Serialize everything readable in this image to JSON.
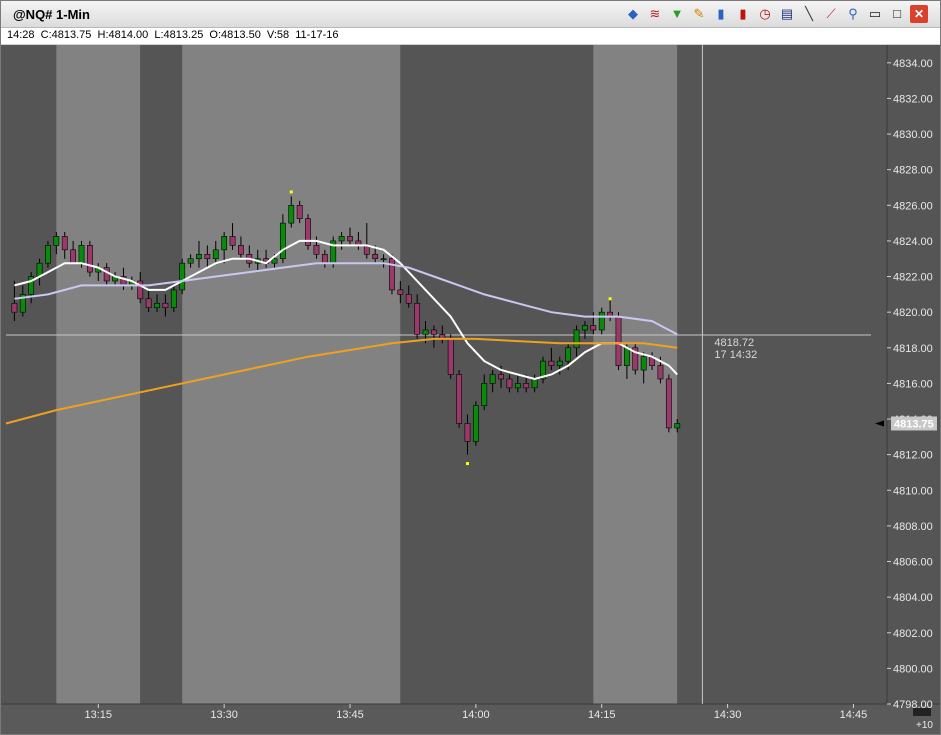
{
  "window": {
    "title": "@NQ# 1-Min",
    "info": "14:28  C:4813.75  H:4814.00  L:4813.25  O:4813.50  V:58  11-17-16"
  },
  "toolbar": [
    {
      "name": "data-icon",
      "glyph": "◆",
      "color": "#2a62c4"
    },
    {
      "name": "rainbow-icon",
      "glyph": "≋",
      "color": "#c02020"
    },
    {
      "name": "funnel-icon",
      "glyph": "▼",
      "color": "#22a022"
    },
    {
      "name": "pencil-icon",
      "glyph": "✎",
      "color": "#d08000"
    },
    {
      "name": "bar-chart-icon",
      "glyph": "▮",
      "color": "#2a62c4"
    },
    {
      "name": "candle-icon",
      "glyph": "▮",
      "color": "#c01010"
    },
    {
      "name": "clock-icon",
      "glyph": "◷",
      "color": "#b01010"
    },
    {
      "name": "document-icon",
      "glyph": "▤",
      "color": "#203080"
    },
    {
      "name": "trendline-icon",
      "glyph": "╲",
      "color": "#303030"
    },
    {
      "name": "zigzag-icon",
      "glyph": "⟋",
      "color": "#c02080"
    },
    {
      "name": "pin-icon",
      "glyph": "⚲",
      "color": "#2a62c4"
    },
    {
      "name": "minimize-icon",
      "glyph": "▭",
      "color": "#202020"
    },
    {
      "name": "maximize-icon",
      "glyph": "□",
      "color": "#202020"
    },
    {
      "name": "close-icon",
      "glyph": "✕",
      "color": "#ffffff"
    }
  ],
  "colors": {
    "dark_band": "#555555",
    "light_band": "#828282",
    "axis_bg": "#555555",
    "up_candle": "#0a8a0a",
    "down_candle": "#9a3a6a",
    "wick": "#000000",
    "ma_white": "#ffffff",
    "ma_lavender": "#c8c8f0",
    "ma_orange": "#f0a020",
    "crosshair": "#c8c8c8",
    "marker": "#ffff00",
    "price_label_bg": "#c8c8c8"
  },
  "chart_data": {
    "type": "candlestick",
    "xlim": [
      "13:04",
      "14:49"
    ],
    "ylim": [
      4798,
      4835
    ],
    "y_ticks": [
      4798,
      4800,
      4802,
      4804,
      4806,
      4808,
      4810,
      4812,
      4814,
      4816,
      4818,
      4820,
      4822,
      4824,
      4826,
      4828,
      4830,
      4832,
      4834
    ],
    "y_tick_labels": [
      "4798.00",
      "4800.00",
      "4802.00",
      "4804.00",
      "4806.00",
      "4808.00",
      "4810.00",
      "4812.00",
      "4814.00",
      "4816.00",
      "4818.00",
      "4820.00",
      "4822.00",
      "4824.00",
      "4826.00",
      "4828.00",
      "4830.00",
      "4832.00",
      "4834.00"
    ],
    "x_ticks": [
      "13:15",
      "13:30",
      "13:45",
      "14:00",
      "14:15",
      "14:30",
      "14:45"
    ],
    "x_axis_extra": "+10",
    "bands": [
      {
        "start": "13:04",
        "end": "13:10",
        "shade": "dark"
      },
      {
        "start": "13:10",
        "end": "13:20",
        "shade": "light"
      },
      {
        "start": "13:20",
        "end": "13:25",
        "shade": "dark"
      },
      {
        "start": "13:25",
        "end": "13:51",
        "shade": "light"
      },
      {
        "start": "13:51",
        "end": "14:14",
        "shade": "dark"
      },
      {
        "start": "14:14",
        "end": "14:24",
        "shade": "light"
      },
      {
        "start": "14:24",
        "end": "14:49",
        "shade": "dark"
      }
    ],
    "candles": [
      [
        "13:05",
        4820.5,
        4821.75,
        4819.5,
        4820.0
      ],
      [
        "13:06",
        4820.0,
        4821.5,
        4819.75,
        4821.0
      ],
      [
        "13:07",
        4821.0,
        4822.25,
        4820.5,
        4822.0
      ],
      [
        "13:08",
        4822.0,
        4823.0,
        4821.5,
        4822.75
      ],
      [
        "13:09",
        4822.75,
        4824.0,
        4822.5,
        4823.75
      ],
      [
        "13:10",
        4823.75,
        4824.5,
        4823.25,
        4824.25
      ],
      [
        "13:11",
        4824.25,
        4824.5,
        4823.0,
        4823.5
      ],
      [
        "13:12",
        4823.5,
        4824.0,
        4822.75,
        4822.75
      ],
      [
        "13:13",
        4822.75,
        4824.0,
        4822.5,
        4823.75
      ],
      [
        "13:14",
        4823.75,
        4824.0,
        4822.0,
        4822.25
      ],
      [
        "13:15",
        4822.25,
        4822.75,
        4821.75,
        4822.5
      ],
      [
        "13:16",
        4822.5,
        4822.75,
        4821.5,
        4821.75
      ],
      [
        "13:17",
        4821.75,
        4822.25,
        4821.5,
        4822.0
      ],
      [
        "13:18",
        4822.0,
        4822.5,
        4821.25,
        4821.5
      ],
      [
        "13:19",
        4821.5,
        4822.0,
        4821.25,
        4821.75
      ],
      [
        "13:20",
        4821.75,
        4822.25,
        4820.5,
        4820.75
      ],
      [
        "13:21",
        4820.75,
        4821.25,
        4820.0,
        4820.25
      ],
      [
        "13:22",
        4820.25,
        4821.0,
        4820.0,
        4820.5
      ],
      [
        "13:23",
        4820.5,
        4821.0,
        4819.75,
        4820.25
      ],
      [
        "13:24",
        4820.25,
        4821.5,
        4820.0,
        4821.25
      ],
      [
        "13:25",
        4821.25,
        4823.0,
        4821.0,
        4822.75
      ],
      [
        "13:26",
        4822.75,
        4823.25,
        4822.5,
        4823.0
      ],
      [
        "13:27",
        4823.0,
        4824.0,
        4822.5,
        4823.25
      ],
      [
        "13:28",
        4823.25,
        4823.75,
        4822.5,
        4823.0
      ],
      [
        "13:29",
        4823.0,
        4824.0,
        4822.75,
        4823.5
      ],
      [
        "13:30",
        4823.5,
        4824.5,
        4822.75,
        4824.25
      ],
      [
        "13:31",
        4824.25,
        4825.0,
        4823.5,
        4823.75
      ],
      [
        "13:32",
        4823.75,
        4824.25,
        4823.0,
        4823.25
      ],
      [
        "13:33",
        4823.25,
        4823.75,
        4822.5,
        4822.75
      ],
      [
        "13:34",
        4822.75,
        4823.5,
        4822.25,
        4823.0
      ],
      [
        "13:35",
        4823.0,
        4823.5,
        4822.5,
        4822.75
      ],
      [
        "13:36",
        4822.75,
        4823.25,
        4822.5,
        4823.0
      ],
      [
        "13:37",
        4823.0,
        4825.5,
        4822.75,
        4825.0
      ],
      [
        "13:38",
        4825.0,
        4826.5,
        4824.75,
        4826.0
      ],
      [
        "13:39",
        4826.0,
        4826.25,
        4825.0,
        4825.25
      ],
      [
        "13:40",
        4825.25,
        4825.5,
        4823.5,
        4823.75
      ],
      [
        "13:41",
        4823.75,
        4824.25,
        4823.0,
        4823.25
      ],
      [
        "13:42",
        4823.25,
        4823.5,
        4822.5,
        4822.75
      ],
      [
        "13:43",
        4822.75,
        4824.25,
        4822.5,
        4824.0
      ],
      [
        "13:44",
        4824.0,
        4824.5,
        4823.5,
        4824.25
      ],
      [
        "13:45",
        4824.25,
        4824.75,
        4823.75,
        4824.0
      ],
      [
        "13:46",
        4824.0,
        4824.5,
        4823.5,
        4823.75
      ],
      [
        "13:47",
        4823.75,
        4825.0,
        4823.0,
        4823.25
      ],
      [
        "13:48",
        4823.25,
        4823.75,
        4822.75,
        4823.0
      ],
      [
        "13:49",
        4823.0,
        4823.25,
        4822.5,
        4823.0
      ],
      [
        "13:50",
        4823.0,
        4823.25,
        4821.0,
        4821.25
      ],
      [
        "13:51",
        4821.25,
        4821.75,
        4820.5,
        4821.0
      ],
      [
        "13:52",
        4821.0,
        4821.5,
        4820.25,
        4820.5
      ],
      [
        "13:53",
        4820.5,
        4821.0,
        4818.5,
        4818.75
      ],
      [
        "13:54",
        4818.75,
        4819.5,
        4818.25,
        4819.0
      ],
      [
        "13:55",
        4819.0,
        4819.25,
        4818.0,
        4818.75
      ],
      [
        "13:56",
        4818.75,
        4819.25,
        4818.25,
        4818.5
      ],
      [
        "13:57",
        4818.5,
        4818.75,
        4816.25,
        4816.5
      ],
      [
        "13:58",
        4816.5,
        4816.75,
        4813.5,
        4813.75
      ],
      [
        "13:59",
        4813.75,
        4814.25,
        4812.0,
        4812.75
      ],
      [
        "14:00",
        4812.75,
        4815.0,
        4812.5,
        4814.75
      ],
      [
        "14:01",
        4814.75,
        4816.5,
        4814.5,
        4816.0
      ],
      [
        "14:02",
        4816.0,
        4816.75,
        4815.5,
        4816.5
      ],
      [
        "14:03",
        4816.5,
        4817.0,
        4815.75,
        4816.25
      ],
      [
        "14:04",
        4816.25,
        4816.5,
        4815.5,
        4815.75
      ],
      [
        "14:05",
        4815.75,
        4816.5,
        4815.5,
        4816.0
      ],
      [
        "14:06",
        4816.0,
        4816.5,
        4815.5,
        4815.75
      ],
      [
        "14:07",
        4815.75,
        4816.5,
        4815.5,
        4816.25
      ],
      [
        "14:08",
        4816.25,
        4817.5,
        4816.0,
        4817.25
      ],
      [
        "14:09",
        4817.25,
        4818.0,
        4816.75,
        4817.0
      ],
      [
        "14:10",
        4817.0,
        4817.5,
        4816.5,
        4817.25
      ],
      [
        "14:11",
        4817.25,
        4818.25,
        4816.75,
        4818.0
      ],
      [
        "14:12",
        4818.0,
        4819.25,
        4817.5,
        4819.0
      ],
      [
        "14:13",
        4819.0,
        4819.5,
        4818.5,
        4819.25
      ],
      [
        "14:14",
        4819.25,
        4820.0,
        4818.75,
        4819.0
      ],
      [
        "14:15",
        4819.0,
        4820.25,
        4818.75,
        4820.0
      ],
      [
        "14:16",
        4820.0,
        4820.75,
        4819.5,
        4819.75
      ],
      [
        "14:17",
        4819.75,
        4820.0,
        4816.75,
        4817.0
      ],
      [
        "14:18",
        4817.0,
        4818.25,
        4816.25,
        4818.0
      ],
      [
        "14:19",
        4818.0,
        4818.25,
        4816.5,
        4816.75
      ],
      [
        "14:20",
        4816.75,
        4817.75,
        4816.0,
        4817.5
      ],
      [
        "14:21",
        4817.5,
        4817.75,
        4816.75,
        4817.0
      ],
      [
        "14:22",
        4817.0,
        4817.5,
        4816.0,
        4816.25
      ],
      [
        "14:23",
        4816.25,
        4816.5,
        4813.25,
        4813.5
      ],
      [
        "14:24",
        4813.5,
        4814.0,
        4813.25,
        4813.75
      ]
    ],
    "series": [
      {
        "color": "white",
        "points": [
          [
            "13:05",
            4821.5
          ],
          [
            "13:07",
            4821.75
          ],
          [
            "13:09",
            4822.25
          ],
          [
            "13:11",
            4822.75
          ],
          [
            "13:13",
            4822.75
          ],
          [
            "13:15",
            4822.5
          ],
          [
            "13:17",
            4822.0
          ],
          [
            "13:19",
            4821.75
          ],
          [
            "13:21",
            4821.25
          ],
          [
            "13:23",
            4821.25
          ],
          [
            "13:25",
            4821.75
          ],
          [
            "13:27",
            4822.25
          ],
          [
            "13:29",
            4822.75
          ],
          [
            "13:31",
            4823.0
          ],
          [
            "13:33",
            4823.0
          ],
          [
            "13:35",
            4822.75
          ],
          [
            "13:37",
            4823.5
          ],
          [
            "13:39",
            4824.0
          ],
          [
            "13:41",
            4824.0
          ],
          [
            "13:43",
            4823.75
          ],
          [
            "13:45",
            4823.75
          ],
          [
            "13:47",
            4823.75
          ],
          [
            "13:49",
            4823.5
          ],
          [
            "13:51",
            4822.75
          ],
          [
            "13:53",
            4821.75
          ],
          [
            "13:55",
            4820.75
          ],
          [
            "13:57",
            4819.75
          ],
          [
            "13:59",
            4818.25
          ],
          [
            "14:01",
            4817.25
          ],
          [
            "14:03",
            4816.75
          ],
          [
            "14:05",
            4816.5
          ],
          [
            "14:07",
            4816.25
          ],
          [
            "14:09",
            4816.5
          ],
          [
            "14:11",
            4817.0
          ],
          [
            "14:13",
            4817.75
          ],
          [
            "14:15",
            4818.25
          ],
          [
            "14:17",
            4818.25
          ],
          [
            "14:19",
            4817.75
          ],
          [
            "14:21",
            4817.5
          ],
          [
            "14:23",
            4817.0
          ],
          [
            "14:24",
            4816.5
          ]
        ]
      },
      {
        "color": "lavender",
        "points": [
          [
            "13:05",
            4820.75
          ],
          [
            "13:09",
            4821.0
          ],
          [
            "13:13",
            4821.5
          ],
          [
            "13:17",
            4821.5
          ],
          [
            "13:21",
            4821.5
          ],
          [
            "13:25",
            4821.75
          ],
          [
            "13:29",
            4822.0
          ],
          [
            "13:33",
            4822.25
          ],
          [
            "13:37",
            4822.5
          ],
          [
            "13:41",
            4822.75
          ],
          [
            "13:45",
            4822.75
          ],
          [
            "13:49",
            4822.75
          ],
          [
            "13:52",
            4822.5
          ],
          [
            "13:55",
            4822.0
          ],
          [
            "13:58",
            4821.5
          ],
          [
            "14:01",
            4821.0
          ],
          [
            "14:05",
            4820.5
          ],
          [
            "14:09",
            4820.0
          ],
          [
            "14:13",
            4819.75
          ],
          [
            "14:17",
            4819.75
          ],
          [
            "14:21",
            4819.5
          ],
          [
            "14:24",
            4818.75
          ]
        ]
      },
      {
        "color": "orange",
        "points": [
          [
            "13:04",
            4813.75
          ],
          [
            "13:10",
            4814.5
          ],
          [
            "13:20",
            4815.5
          ],
          [
            "13:30",
            4816.5
          ],
          [
            "13:40",
            4817.5
          ],
          [
            "13:50",
            4818.25
          ],
          [
            "13:55",
            4818.5
          ],
          [
            "14:00",
            4818.5
          ],
          [
            "14:10",
            4818.25
          ],
          [
            "14:20",
            4818.25
          ],
          [
            "14:24",
            4818.0
          ]
        ]
      }
    ],
    "markers": [
      {
        "x": "13:38",
        "y": 4826.75
      },
      {
        "x": "13:59",
        "y": 4811.5
      },
      {
        "x": "14:16",
        "y": 4820.75
      }
    ],
    "crosshair": {
      "x": "14:27",
      "y": 4818.72,
      "label_price": "4818.72",
      "label_time": "17 14:32"
    },
    "last_price": {
      "value": 4813.75,
      "label": "4813.75"
    }
  }
}
